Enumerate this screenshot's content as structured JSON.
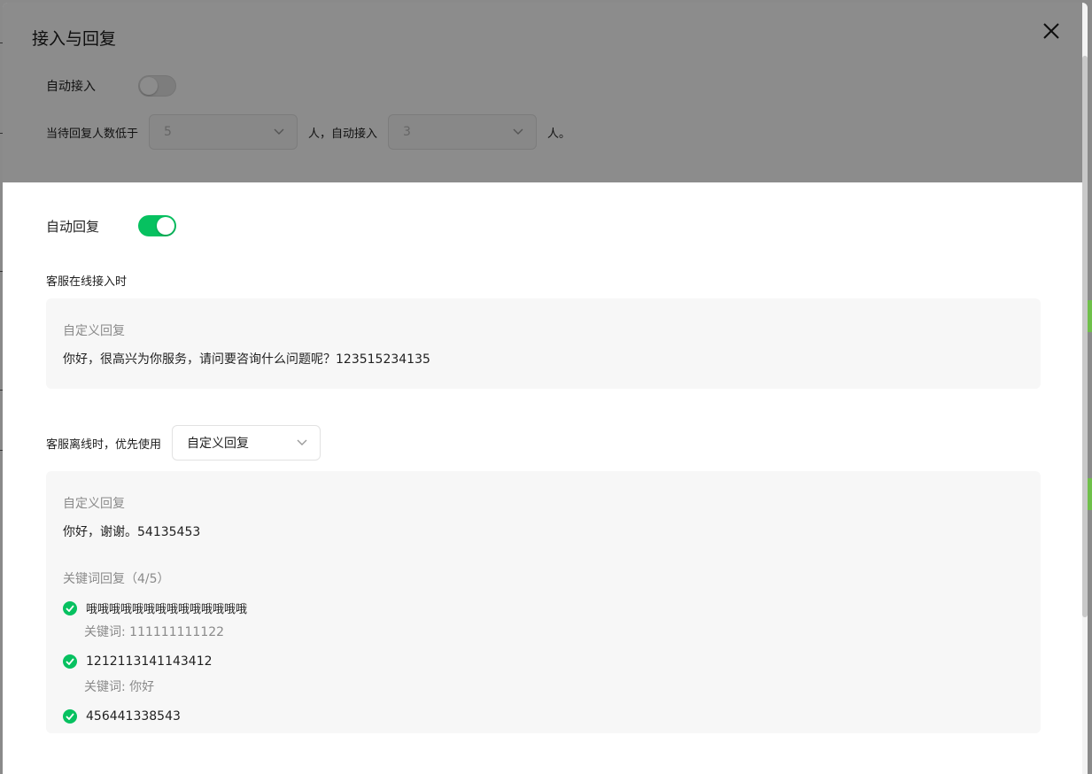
{
  "modal": {
    "title": "接入与回复"
  },
  "auto_access": {
    "label": "自动接入",
    "enabled": false,
    "rule_prefix": "当待回复人数低于",
    "threshold_value": "5",
    "rule_middle": "人，自动接入",
    "count_value": "3",
    "rule_suffix": "人。"
  },
  "auto_reply": {
    "label": "自动回复",
    "enabled": true,
    "online_section_label": "客服在线接入时",
    "online_card": {
      "heading": "自定义回复",
      "message": "你好，很高兴为你服务，请问要咨询什么问题呢？123515234135"
    },
    "offline_prefix": "客服离线时，优先使用",
    "offline_select_value": "自定义回复",
    "offline_card": {
      "heading": "自定义回复",
      "message": "你好，谢谢。54135453",
      "keyword_heading": "关键词回复（4/5）",
      "keyword_items": [
        {
          "reply": "哦哦哦哦哦哦哦哦哦哦哦哦哦哦",
          "keyword_label": "关键词: 111111111122"
        },
        {
          "reply": "1212113141143412",
          "keyword_label": "关键词: 你好"
        },
        {
          "reply": "456441338543",
          "keyword_label": ""
        }
      ]
    }
  },
  "colors": {
    "accent": "#07c160",
    "card_bg": "#f7f7f7",
    "muted_text": "#8a8a8a"
  },
  "icons": {
    "close": "close-icon",
    "chevron": "chevron-down-icon",
    "check": "check-circle-icon"
  }
}
